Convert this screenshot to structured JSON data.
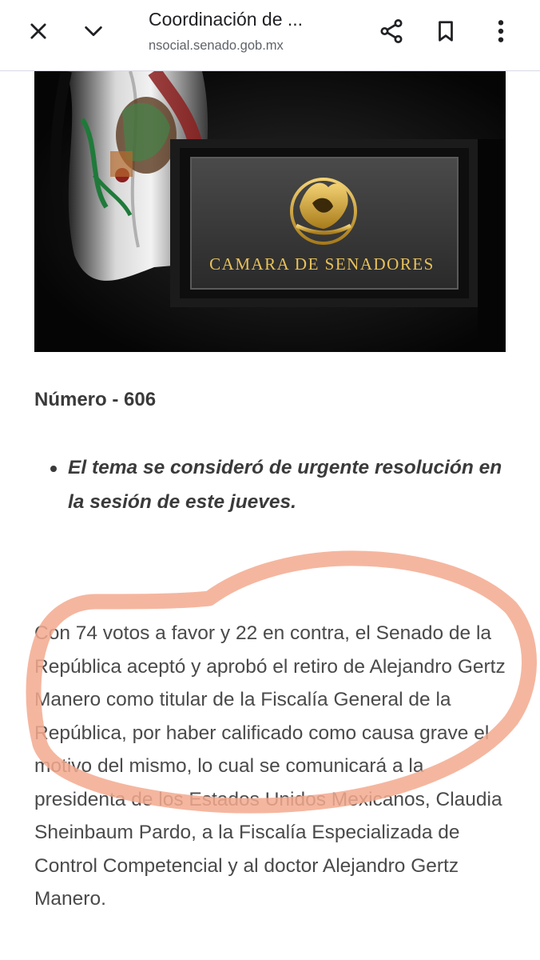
{
  "browser": {
    "page_title": "Coordinación de ...",
    "url": "nsocial.senado.gob.mx",
    "buttons": {
      "close": "close-icon",
      "collapse": "chevron-down-icon",
      "share": "share-icon",
      "bookmark": "bookmark-icon",
      "menu": "more-vert-icon"
    }
  },
  "hero": {
    "plaque_text": "CAMARA DE SENADORES"
  },
  "article": {
    "number": "Número - 606",
    "bullets": [
      "El tema se consideró de urgente resolución en la sesión de este jueves."
    ],
    "paragraph": "Con 74 votos a favor y 22 en contra, el Senado de la República aceptó y aprobó el retiro de Alejandro Gertz Manero como titular de la Fiscalía General de la República, por haber calificado como causa grave el motivo del mismo, lo cual se comunicará a la presidenta de los Estados Unidos Mexicanos, Claudia Sheinbaum Pardo, a la Fiscalía Especializada de Control Competencial y al doctor Alejandro Gertz Manero."
  },
  "annotation": {
    "color": "#f3a98e"
  }
}
